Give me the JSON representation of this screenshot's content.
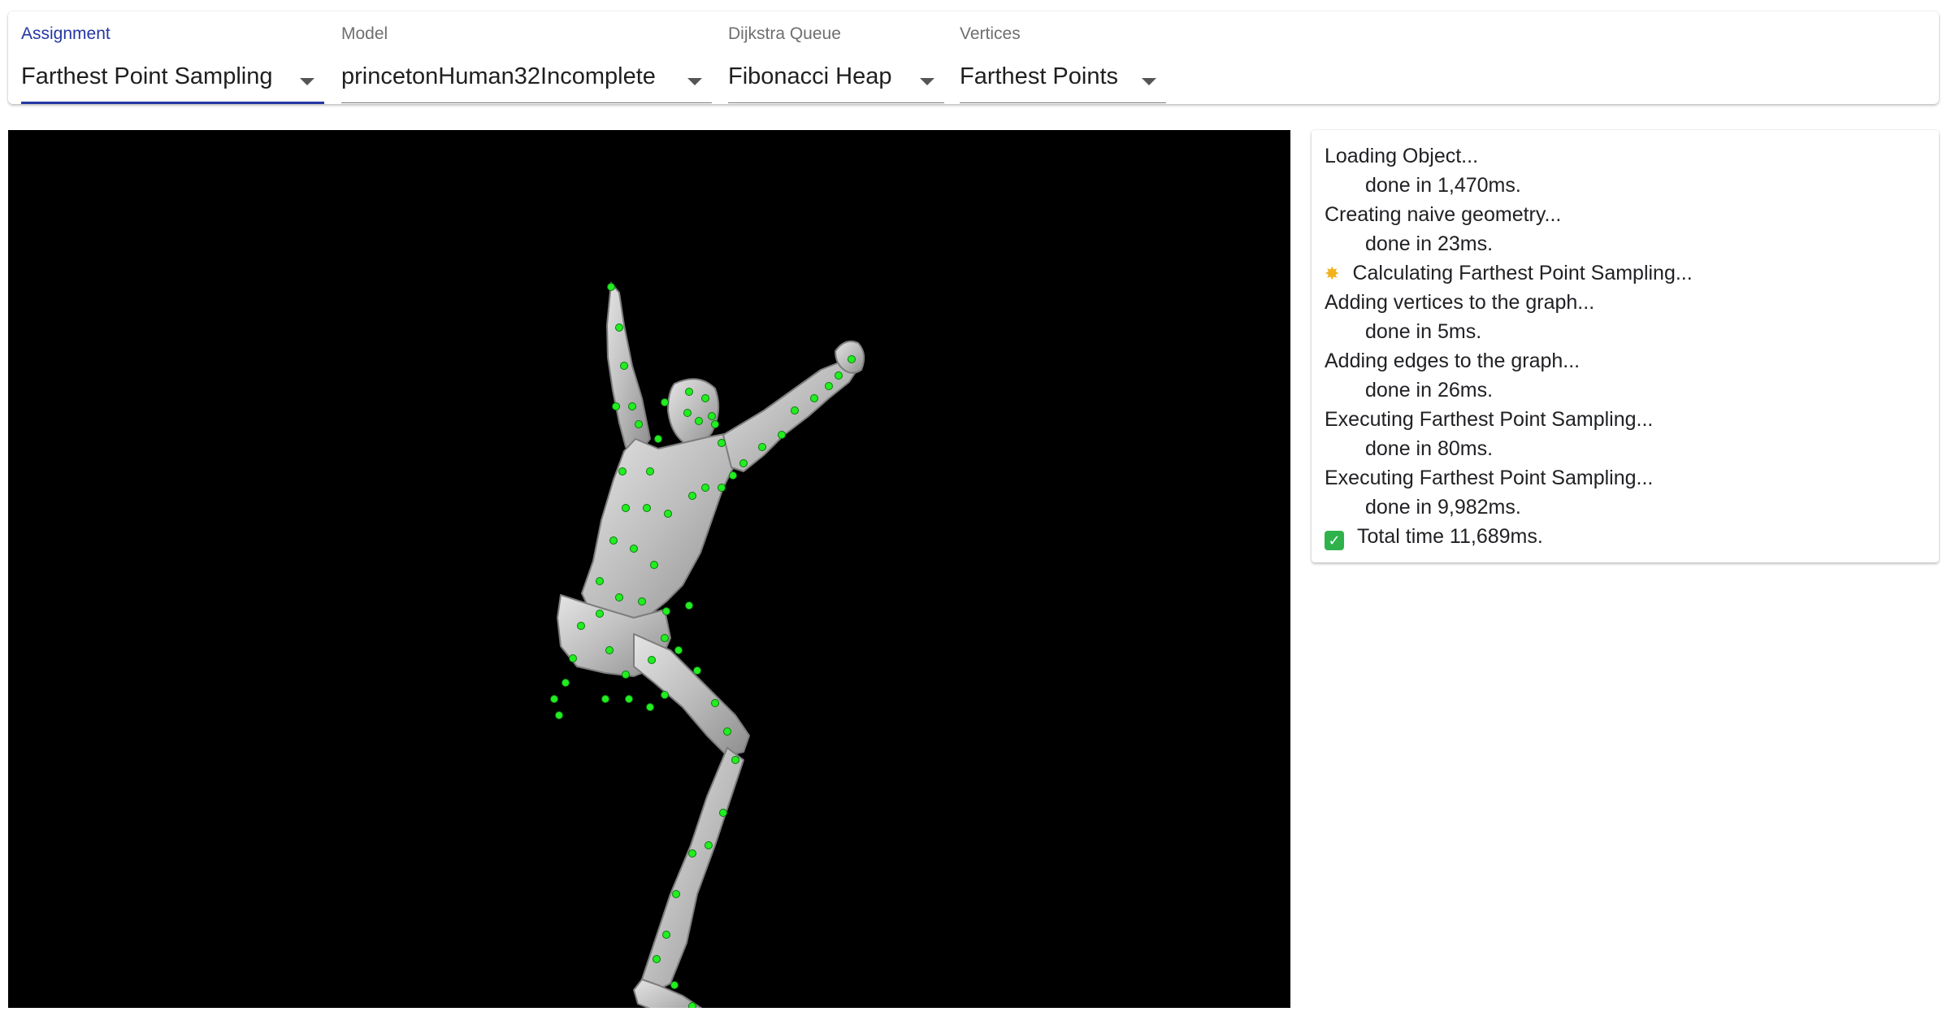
{
  "toolbar": {
    "fields": [
      {
        "label": "Assignment",
        "value": "Farthest Point Sampling"
      },
      {
        "label": "Model",
        "value": "princetonHuman32Incomplete"
      },
      {
        "label": "Dijkstra Queue",
        "value": "Fibonacci Heap"
      },
      {
        "label": "Vertices",
        "value": "Farthest Points"
      }
    ],
    "active_color": "#2537a3"
  },
  "viewport": {
    "background": "#000000",
    "mesh_color": "#c7c7c7",
    "point_color": "#22ee22"
  },
  "log": {
    "lines": [
      {
        "text": "Loading Object...",
        "indent": false,
        "icon": ""
      },
      {
        "text": "done in 1,470ms.",
        "indent": true,
        "icon": ""
      },
      {
        "text": "Creating naive geometry...",
        "indent": false,
        "icon": ""
      },
      {
        "text": "done in 23ms.",
        "indent": true,
        "icon": ""
      },
      {
        "text": "Calculating Farthest Point Sampling...",
        "indent": false,
        "icon": "sparkle-icon"
      },
      {
        "text": "Adding vertices to the graph...",
        "indent": false,
        "icon": ""
      },
      {
        "text": "done in 5ms.",
        "indent": true,
        "icon": ""
      },
      {
        "text": "Adding edges to the graph...",
        "indent": false,
        "icon": ""
      },
      {
        "text": "done in 26ms.",
        "indent": true,
        "icon": ""
      },
      {
        "text": "Executing Farthest Point Sampling...",
        "indent": false,
        "icon": ""
      },
      {
        "text": "done in 80ms.",
        "indent": true,
        "icon": ""
      },
      {
        "text": "Executing Farthest Point Sampling...",
        "indent": false,
        "icon": ""
      },
      {
        "text": "done in 9,982ms.",
        "indent": true,
        "icon": ""
      },
      {
        "text": "Total time 11,689ms.",
        "indent": false,
        "icon": "check-icon"
      }
    ]
  }
}
